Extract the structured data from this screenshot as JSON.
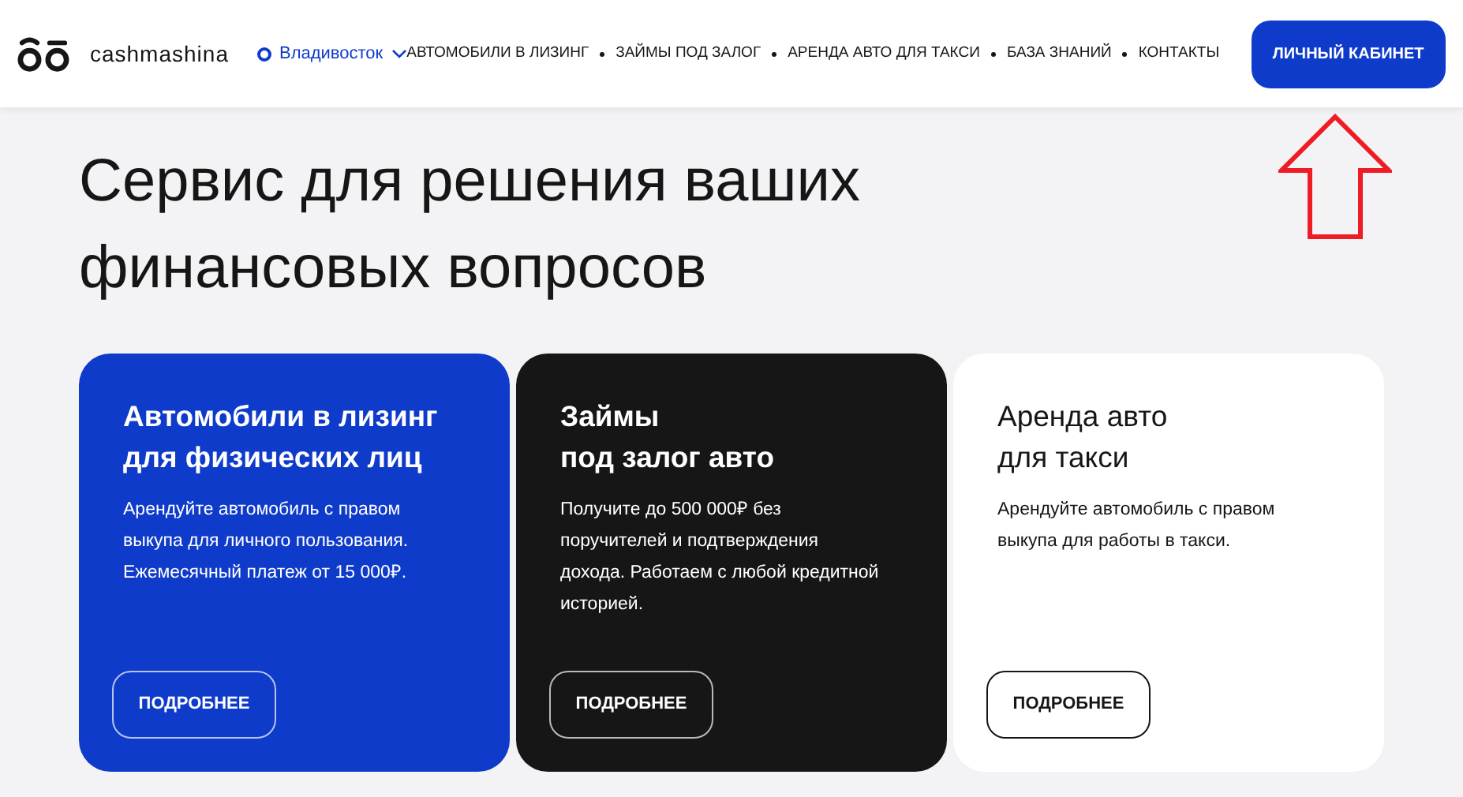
{
  "header": {
    "logo_text": "cashmashina",
    "city": "Владивосток",
    "nav": [
      "АВТОМОБИЛИ В ЛИЗИНГ",
      "ЗАЙМЫ ПОД ЗАЛОГ",
      "АРЕНДА АВТО ДЛЯ ТАКСИ",
      "БАЗА ЗНАНИЙ",
      "КОНТАКТЫ"
    ],
    "account_button": "ЛИЧНЫЙ КАБИНЕТ"
  },
  "hero": {
    "title_lines": [
      "Сервис для решения ваших",
      "финансовых вопросов"
    ]
  },
  "cards": [
    {
      "kind": "blue",
      "title_lines": [
        "Автомобили в лизинг",
        "для физических лиц"
      ],
      "text_lines": [
        "Арендуйте автомобиль с правом",
        "выкупа для личного пользования.",
        "Ежемесячный платеж от 15 000₽."
      ],
      "button": "ПОДРОБНЕЕ"
    },
    {
      "kind": "dark",
      "title_lines": [
        "Займы",
        "под залог авто"
      ],
      "text_lines": [
        "Получите до 500 000₽ без",
        "поручителей и подтверждения",
        "дохода. Работаем с любой кредитной",
        "историей."
      ],
      "button": "ПОДРОБНЕЕ"
    },
    {
      "kind": "light",
      "title_lines": [
        "Аренда авто",
        "для такси"
      ],
      "text_lines": [
        "Арендуйте автомобиль с правом",
        "выкупа для работы в такси."
      ],
      "button": "ПОДРОБНЕЕ"
    }
  ]
}
